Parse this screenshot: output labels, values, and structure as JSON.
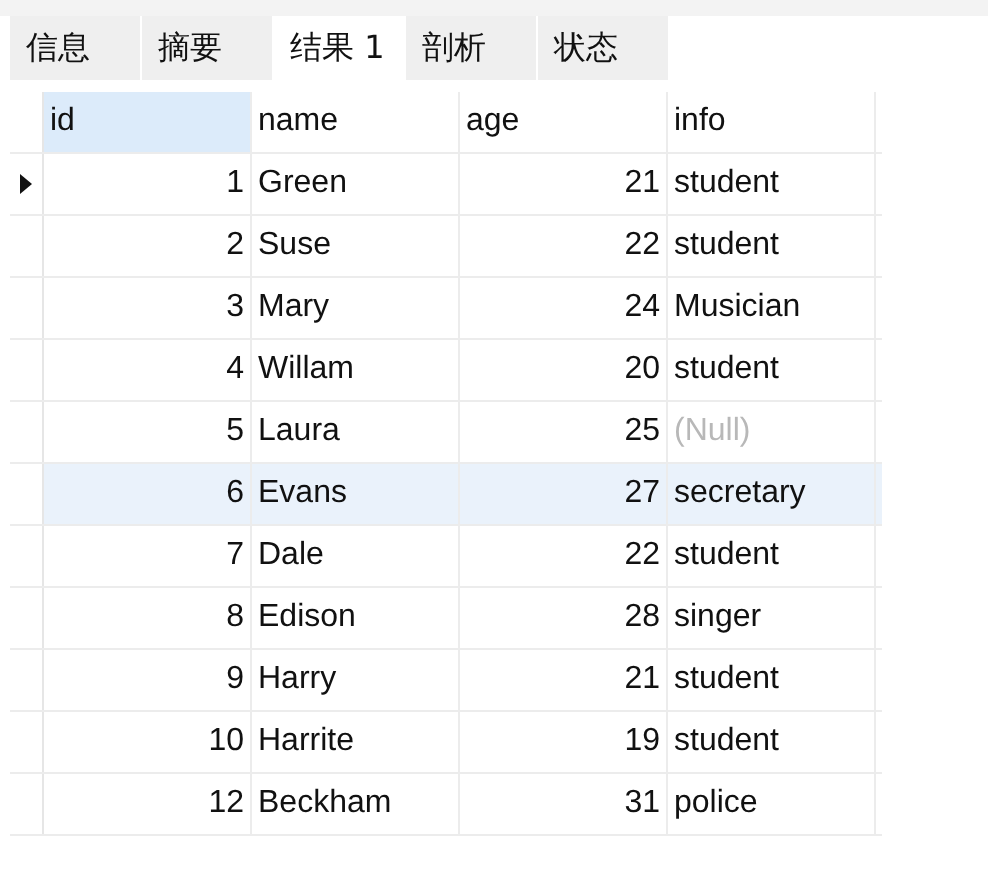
{
  "tabs": [
    {
      "label": "信息",
      "selected": false
    },
    {
      "label": "摘要",
      "selected": false
    },
    {
      "label": "结果 1",
      "selected": true
    },
    {
      "label": "剖析",
      "selected": false
    },
    {
      "label": "状态",
      "selected": false
    }
  ],
  "table": {
    "columns": [
      {
        "label": "id",
        "selected": true
      },
      {
        "label": "name",
        "selected": false
      },
      {
        "label": "age",
        "selected": false
      },
      {
        "label": "info",
        "selected": false
      }
    ],
    "rows": [
      {
        "cells": [
          "1",
          "Green",
          "21",
          "student"
        ],
        "info_null": false,
        "current": true,
        "highlighted": false
      },
      {
        "cells": [
          "2",
          "Suse",
          "22",
          "student"
        ],
        "info_null": false,
        "current": false,
        "highlighted": false
      },
      {
        "cells": [
          "3",
          "Mary",
          "24",
          "Musician"
        ],
        "info_null": false,
        "current": false,
        "highlighted": false
      },
      {
        "cells": [
          "4",
          "Willam",
          "20",
          "student"
        ],
        "info_null": false,
        "current": false,
        "highlighted": false
      },
      {
        "cells": [
          "5",
          "Laura",
          "25",
          "(Null)"
        ],
        "info_null": true,
        "current": false,
        "highlighted": false
      },
      {
        "cells": [
          "6",
          "Evans",
          "27",
          "secretary"
        ],
        "info_null": false,
        "current": false,
        "highlighted": true
      },
      {
        "cells": [
          "7",
          "Dale",
          "22",
          "student"
        ],
        "info_null": false,
        "current": false,
        "highlighted": false
      },
      {
        "cells": [
          "8",
          "Edison",
          "28",
          "singer"
        ],
        "info_null": false,
        "current": false,
        "highlighted": false
      },
      {
        "cells": [
          "9",
          "Harry",
          "21",
          "student"
        ],
        "info_null": false,
        "current": false,
        "highlighted": false
      },
      {
        "cells": [
          "10",
          "Harrite",
          "19",
          "student"
        ],
        "info_null": false,
        "current": false,
        "highlighted": false
      },
      {
        "cells": [
          "12",
          "Beckham",
          "31",
          "police"
        ],
        "info_null": false,
        "current": false,
        "highlighted": false
      }
    ]
  }
}
